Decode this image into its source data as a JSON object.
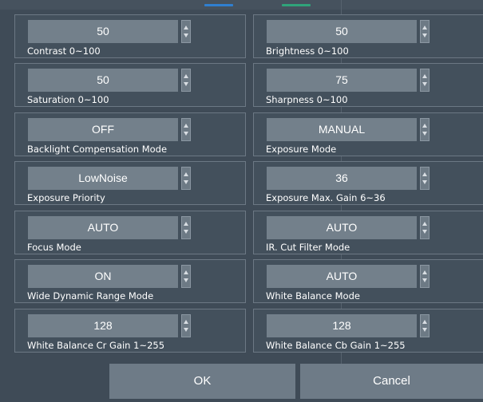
{
  "colors": {
    "background": "#3f4b57",
    "field_border": "#6c7884",
    "spin_box": "#73808b",
    "button": "#6e7b87",
    "text": "#ffffff",
    "top_mark_blue": "#2f7fd0",
    "top_mark_green": "#2fa37a"
  },
  "fields": [
    {
      "value": "50",
      "label": "Contrast 0~100"
    },
    {
      "value": "50",
      "label": "Brightness 0~100"
    },
    {
      "value": "50",
      "label": "Saturation 0~100"
    },
    {
      "value": "75",
      "label": "Sharpness 0~100"
    },
    {
      "value": "OFF",
      "label": "Backlight Compensation Mode"
    },
    {
      "value": "MANUAL",
      "label": "Exposure Mode"
    },
    {
      "value": "LowNoise",
      "label": "Exposure Priority"
    },
    {
      "value": "36",
      "label": "Exposure Max. Gain 6~36"
    },
    {
      "value": "AUTO",
      "label": "Focus Mode"
    },
    {
      "value": "AUTO",
      "label": "IR. Cut Filter Mode"
    },
    {
      "value": "ON",
      "label": "Wide Dynamic Range Mode"
    },
    {
      "value": "AUTO",
      "label": "White Balance Mode"
    },
    {
      "value": "128",
      "label": "White Balance Cr Gain 1~255"
    },
    {
      "value": "128",
      "label": "White Balance Cb Gain 1~255"
    }
  ],
  "buttons": {
    "ok_label": "OK",
    "cancel_label": "Cancel"
  }
}
